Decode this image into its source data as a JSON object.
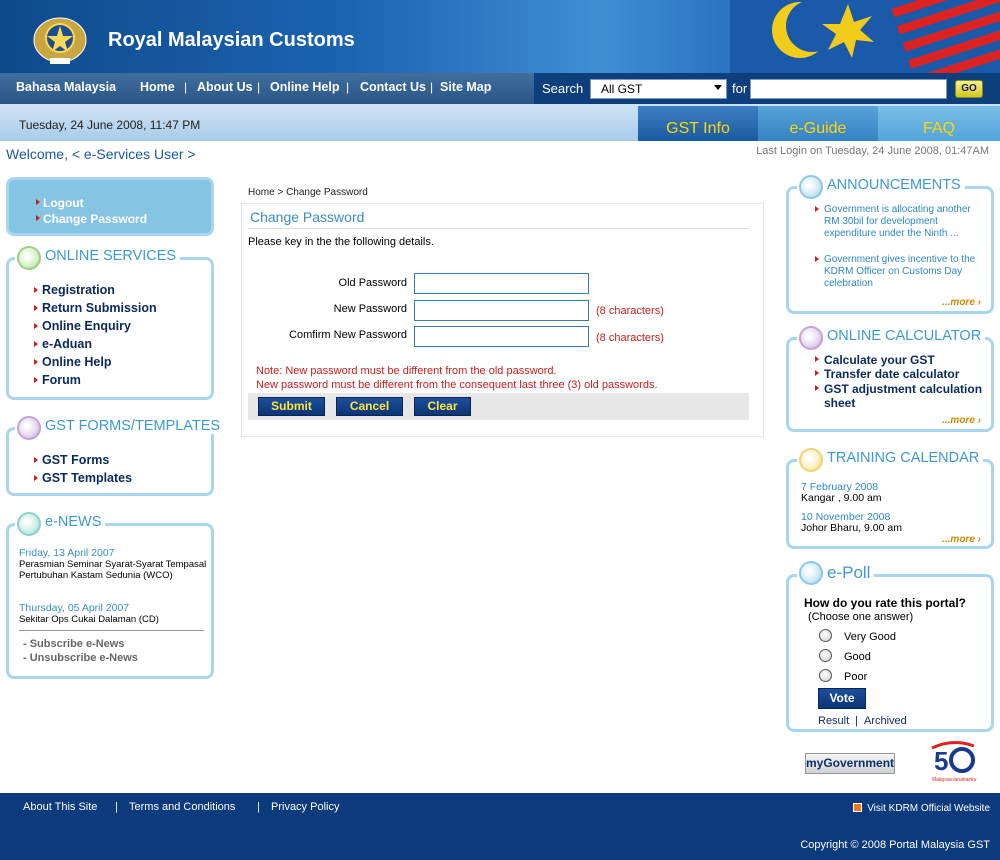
{
  "header": {
    "title": "Royal Malaysian Customs"
  },
  "nav": {
    "links": [
      "Bahasa Malaysia",
      "Home",
      "About Us",
      "Online Help",
      "Contact Us",
      "Site Map"
    ],
    "separator": "|",
    "search_label": "Search",
    "search_select_value": "All GST",
    "for_label": "for",
    "search_input_value": "",
    "go_label": "GO"
  },
  "date_bar": {
    "datetime": "Tuesday, 24 June 2008, 11:47 PM",
    "tabs": [
      "GST Info",
      "e-Guide",
      "FAQ"
    ]
  },
  "welcome": "Welcome, < e-Services User >",
  "last_login": "Last Login on Tuesday, 24 June 2008, 01:47AM",
  "user_menu": [
    "Logout",
    "Change Password"
  ],
  "online_services": {
    "title": "ONLINE SERVICES",
    "items": [
      "Registration",
      "Return Submission",
      "Online Enquiry",
      "e-Aduan",
      "Online Help",
      "Forum"
    ]
  },
  "gst_forms": {
    "title": "GST FORMS/TEMPLATES",
    "items": [
      "GST Forms",
      "GST Templates"
    ]
  },
  "enews": {
    "title": "e-NEWS",
    "items": [
      {
        "date": "Friday, 13 April 2007",
        "text": "Perasmian Seminar Syarat-Syarat Tempasal Pertubuhan Kastam Sedunia (WCO)"
      },
      {
        "date": "Thursday, 05 April 2007",
        "text": "Sekitar Ops Cukai Dalaman (CD)"
      }
    ],
    "subscribe": "- Subscribe e-News",
    "unsubscribe": "- Unsubscribe e-News"
  },
  "breadcrumb": "Home > Change Password",
  "form": {
    "title": "Change Password",
    "intro": "Please key in the the following details.",
    "fields": [
      {
        "label": "Old Password",
        "value": "",
        "hint": ""
      },
      {
        "label": "New Password",
        "value": "",
        "hint": "(8 characters)"
      },
      {
        "label": "Comfirm New Password",
        "value": "",
        "hint": "(8 characters)"
      }
    ],
    "note1": "Note: New password must be different from the old password.",
    "note2": "New password must be different from the consequent last three (3) old passwords.",
    "buttons": [
      "Submit",
      "Cancel",
      "Clear"
    ]
  },
  "announcements": {
    "title": "ANNOUNCEMENTS",
    "items": [
      "Government is allocating another RM 30bil for development expenditure under the Ninth ...",
      "Government gives incentive to the KDRM Officer on Customs Day celebration"
    ],
    "more": "...more ›"
  },
  "calculator": {
    "title": "ONLINE CALCULATOR",
    "items": [
      "Calculate your GST",
      "Transfer date calculator",
      "GST adjustment calculation sheet"
    ],
    "more": "...more ›"
  },
  "training": {
    "title": "TRAINING CALENDAR",
    "items": [
      {
        "date": "7 February 2008",
        "location": "Kangar , 9.00 am"
      },
      {
        "date": "10 November 2008",
        "location": "Johor Bharu, 9.00 am"
      }
    ],
    "more": "...more ›"
  },
  "poll": {
    "title": "e-Poll",
    "question": "How do you rate this portal?",
    "instruction": "(Choose one answer)",
    "options": [
      "Very Good",
      "Good",
      "Poor"
    ],
    "vote": "Vote",
    "result": "Result",
    "separator": "|",
    "archived": "Archived"
  },
  "logos": {
    "mygov": "myGovernment",
    "anniv_caption": "Malaysia tanahairku"
  },
  "footer": {
    "links": [
      "About This Site",
      "Terms and Conditions",
      "Privacy Policy"
    ],
    "separator": "|",
    "kdrm": "Visit KDRM Official Website",
    "copyright": "Copyright © 2008 Portal Malaysia GST"
  },
  "colors": {
    "header_blue": "#0d4a8c",
    "footer_blue": "#0b3a7d",
    "tab_text": "#ffd700",
    "panel_border": "#a8d6ec",
    "warning_red": "#c62020"
  }
}
